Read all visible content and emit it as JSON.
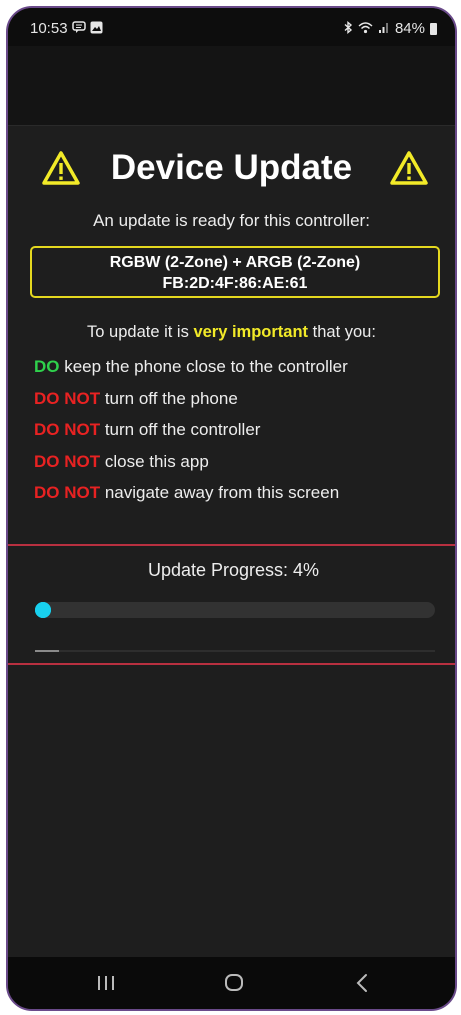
{
  "status_bar": {
    "time": "10:53",
    "battery": "84%",
    "icons": [
      "message-icon",
      "gallery-icon",
      "bluetooth-icon",
      "wifi-icon",
      "signal-icon",
      "battery-icon"
    ]
  },
  "header": {
    "title": "Device Update",
    "warning_icon": "warning-icon",
    "warning_color": "#f2ea28"
  },
  "subtitle": "An update is ready for this controller:",
  "device": {
    "name": "RGBW (2-Zone) + ARGB (2-Zone)",
    "mac": "FB:2D:4F:86:AE:61"
  },
  "instructions": {
    "intro_prefix": "To update it is ",
    "intro_emphasis": "very important",
    "intro_suffix": " that you:",
    "rules": [
      {
        "prefix": "DO",
        "type": "do",
        "text": " keep the phone close to the controller"
      },
      {
        "prefix": "DO NOT",
        "type": "dont",
        "text": " turn off the phone"
      },
      {
        "prefix": "DO NOT",
        "type": "dont",
        "text": " turn off the controller"
      },
      {
        "prefix": "DO NOT",
        "type": "dont",
        "text": " close this app"
      },
      {
        "prefix": "DO NOT",
        "type": "dont",
        "text": " navigate away from this screen"
      }
    ]
  },
  "progress": {
    "label": "Update Progress: 4%",
    "value_percent": 4,
    "sub_value_percent": 6,
    "fill_color": "#18d0ee"
  },
  "colors": {
    "do": "#2fd14c",
    "dont": "#e82222",
    "accent_border": "#e5d81f"
  },
  "navbar": {
    "buttons": [
      "recent-apps-icon",
      "home-icon",
      "back-icon"
    ]
  }
}
